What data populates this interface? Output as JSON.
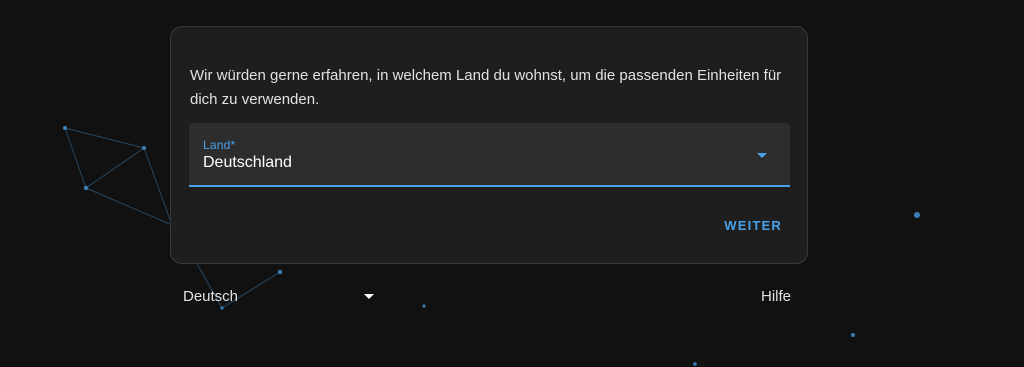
{
  "dialog": {
    "intro_text": "Wir würden gerne erfahren, in welchem Land du wohnst, um die passenden Einheiten für dich zu verwenden.",
    "country_field": {
      "label": "Land*",
      "value": "Deutschland"
    },
    "next_button": "WEITER"
  },
  "footer": {
    "language_selector": "Deutsch",
    "help_link": "Hilfe"
  },
  "theme": {
    "accent": "#4aa1e8",
    "background": "#111111",
    "card": "#1e1e1e"
  }
}
